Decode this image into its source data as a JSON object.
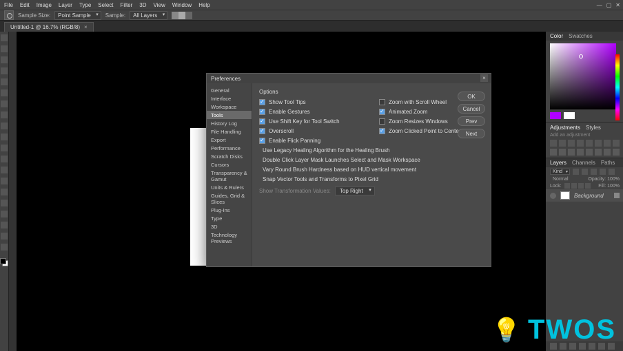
{
  "app": {
    "title": "Preferences"
  },
  "menu": [
    "File",
    "Edit",
    "Image",
    "Layer",
    "Type",
    "Select",
    "Filter",
    "3D",
    "View",
    "Window",
    "Help"
  ],
  "optionsbar": {
    "sample_size_label": "Sample Size:",
    "sample_size_value": "Point Sample",
    "sample_label": "Sample:",
    "sample_value": "All Layers"
  },
  "document": {
    "tab_title": "Untitled-1 @ 16.7% (RGB/8)"
  },
  "dialog": {
    "title": "Preferences",
    "categories": [
      "General",
      "Interface",
      "Workspace",
      "Tools",
      "History Log",
      "File Handling",
      "Export",
      "Performance",
      "Scratch Disks",
      "Cursors",
      "Transparency & Gamut",
      "Units & Rulers",
      "Guides, Grid & Slices",
      "Plug-Ins",
      "Type",
      "3D",
      "Technology Previews"
    ],
    "active_category_index": 3,
    "section_title": "Options",
    "left_options": [
      {
        "label": "Show Tool Tips",
        "checked": true
      },
      {
        "label": "Enable Gestures",
        "checked": true
      },
      {
        "label": "Use Shift Key for Tool Switch",
        "checked": true
      },
      {
        "label": "Overscroll",
        "checked": true
      },
      {
        "label": "Enable Flick Panning",
        "checked": true
      }
    ],
    "right_options": [
      {
        "label": "Zoom with Scroll Wheel",
        "checked": false
      },
      {
        "label": "Animated Zoom",
        "checked": true
      },
      {
        "label": "Zoom Resizes Windows",
        "checked": false
      },
      {
        "label": "Zoom Clicked Point to Center",
        "checked": true
      }
    ],
    "wide_options": [
      {
        "label": "Use Legacy Healing Algorithm for the Healing Brush",
        "checked": false
      },
      {
        "label": "Double Click Layer Mask Launches Select and Mask Workspace",
        "checked": false
      },
      {
        "label": "Vary Round Brush Hardness based on HUD vertical movement",
        "checked": true
      },
      {
        "label": "Snap Vector Tools and Transforms to Pixel Grid",
        "checked": true
      }
    ],
    "trans_label": "Show Transformation Values:",
    "trans_value": "Top Right",
    "buttons": {
      "ok": "OK",
      "cancel": "Cancel",
      "prev": "Prev",
      "next": "Next"
    }
  },
  "right_panels": {
    "color_tabs": [
      "Color",
      "Swatches"
    ],
    "adjust_tabs": [
      "Adjustments",
      "Styles"
    ],
    "adjust_hint": "Add an adjustment",
    "layers_tabs": [
      "Layers",
      "Channels",
      "Paths"
    ],
    "kind_label": "Kind",
    "blend_mode": "Normal",
    "opacity_label": "Opacity:",
    "opacity_value": "100%",
    "lock_label": "Lock:",
    "fill_label": "Fill:",
    "fill_value": "100%",
    "layer_name": "Background"
  },
  "icons": {
    "close": "×",
    "dropdown": "▾"
  },
  "watermark": {
    "text": "TWOS"
  }
}
